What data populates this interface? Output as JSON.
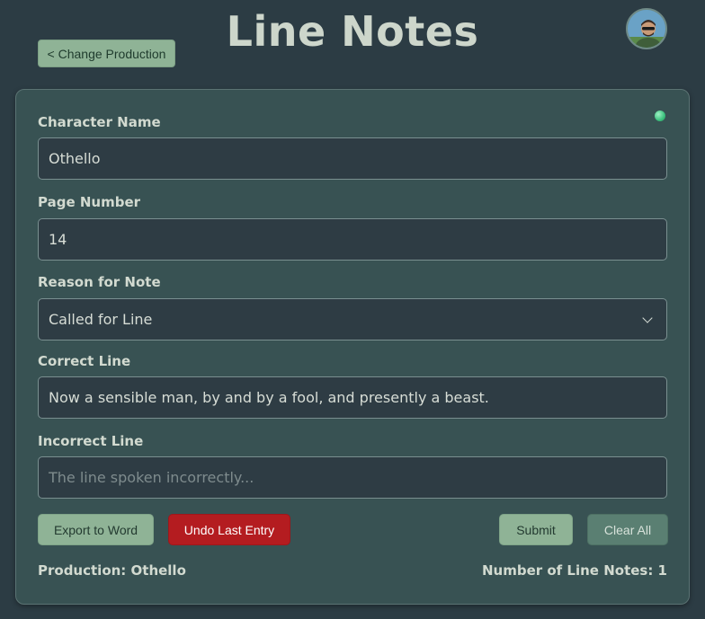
{
  "header": {
    "title": "Line Notes",
    "change_production_label": "< Change Production"
  },
  "form": {
    "character_name": {
      "label": "Character Name",
      "value": "Othello"
    },
    "page_number": {
      "label": "Page Number",
      "value": "14"
    },
    "reason": {
      "label": "Reason for Note",
      "value": "Called for Line"
    },
    "correct_line": {
      "label": "Correct Line",
      "value": "Now a sensible man, by and by a fool, and presently a beast."
    },
    "incorrect_line": {
      "label": "Incorrect Line",
      "value": "",
      "placeholder": "The line spoken incorrectly..."
    }
  },
  "actions": {
    "export_label": "Export to Word",
    "undo_label": "Undo Last Entry",
    "submit_label": "Submit",
    "clear_label": "Clear All"
  },
  "footer": {
    "production": "Production: Othello",
    "count": "Number of Line Notes: 1"
  },
  "colors": {
    "background": "#2c3c44",
    "card": "#385253",
    "accent_green": "#8fb396",
    "danger": "#b41c20",
    "status_online": "#3cc27e"
  }
}
